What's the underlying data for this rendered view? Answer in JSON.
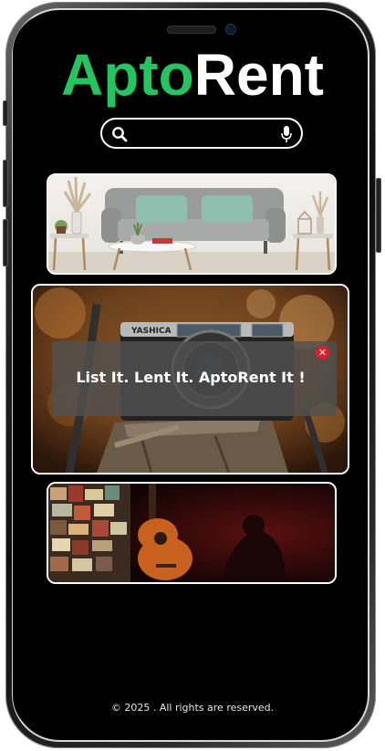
{
  "app": {
    "logo_part1": "Apto",
    "logo_part2": "Rent",
    "brand_green": "#22c55e"
  },
  "search": {
    "value": "",
    "placeholder": "",
    "left_icon": "search-icon",
    "right_icon": "microphone-icon"
  },
  "cards": [
    {
      "name": "living-room-sofa"
    },
    {
      "name": "yashica-camera"
    },
    {
      "name": "acoustic-guitar"
    }
  ],
  "camera_brand_text": "YASHICA",
  "popup": {
    "message": "List It. Lent It. AptoRent It !",
    "close_label": "✕",
    "close_color": "#e11d2a"
  },
  "footer": {
    "text": "© 2025 . All rights are reserved."
  }
}
